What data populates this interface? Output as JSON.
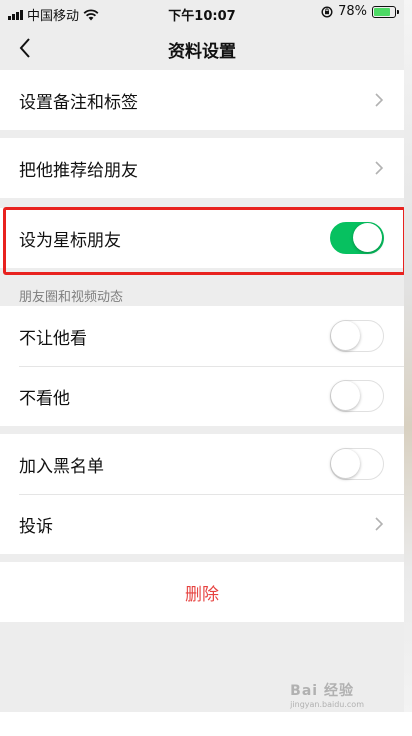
{
  "status": {
    "carrier": "中国移动",
    "time": "下午10:07",
    "battery": "78%",
    "battery_level": 0.78
  },
  "nav": {
    "title": "资料设置"
  },
  "groups": {
    "tags": {
      "label": "设置备注和标签"
    },
    "recommend": {
      "label": "把他推荐给朋友"
    },
    "star": {
      "label": "设为星标朋友",
      "on": true
    }
  },
  "moments": {
    "header": "朋友圈和视频动态",
    "hide_from": {
      "label": "不让他看",
      "on": false
    },
    "dont_see": {
      "label": "不看他",
      "on": false
    }
  },
  "block": {
    "blacklist": {
      "label": "加入黑名单",
      "on": false
    },
    "report": {
      "label": "投诉"
    }
  },
  "delete": {
    "label": "删除"
  },
  "watermark": {
    "brand": "Bai 经验",
    "url": "jingyan.baidu.com"
  },
  "colors": {
    "accent_green": "#07c160",
    "danger_red": "#e64340",
    "highlight_red": "#e8221f"
  }
}
